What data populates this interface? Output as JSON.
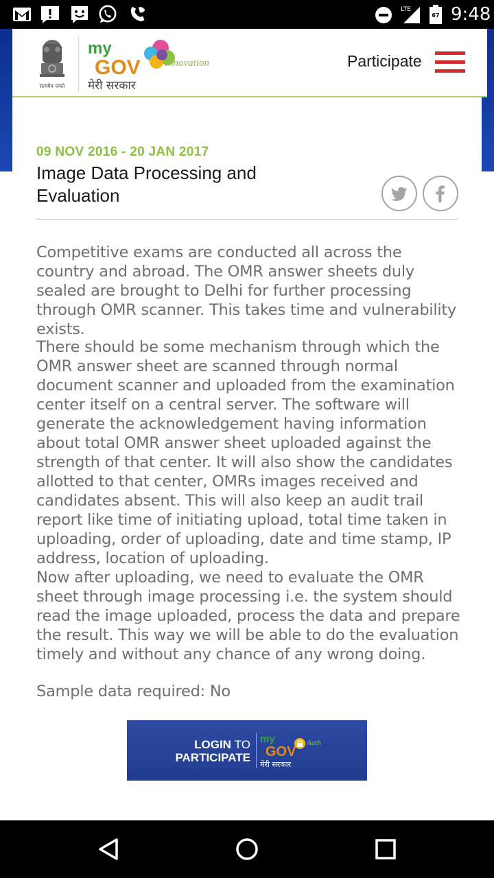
{
  "status_bar": {
    "time": "9:48",
    "network": "LTE",
    "battery_level": "67",
    "icons": [
      "gmail-icon",
      "alert-icon",
      "message-icon",
      "whatsapp-icon",
      "missed-call-icon",
      "do-not-disturb-icon",
      "signal-icon",
      "battery-icon"
    ]
  },
  "header": {
    "logo_brand_lines": [
      "my",
      "GOV",
      "मेरी सरकार",
      "Innovation"
    ],
    "emblem_motto": "सत्यमेव जयते",
    "participate_label": "Participate",
    "menu_icon": "hamburger-menu-icon",
    "colors": {
      "menu": "#d02e2e",
      "divider": "#a8cf74"
    }
  },
  "task": {
    "date_range": "09 NOV 2016 - 20 JAN 2017",
    "title": "Image Data Processing and Evaluation",
    "share": {
      "twitter_icon": "twitter-icon",
      "facebook_icon": "facebook-icon"
    },
    "paragraphs": [
      "Competitive exams are conducted all across the country and abroad. The OMR answer sheets duly sealed are brought to Delhi for further processing through OMR scanner. This takes time and vulnerability exists.",
      "There should be some mechanism through which the OMR answer sheet are scanned through normal document scanner and uploaded from the examination center itself on a central server. The software will generate the acknowledgement having information about total OMR answer sheet uploaded against the strength of that center. It will also show the candidates allotted to that center, OMRs images received and candidates absent. This will also keep an audit trail report like time of initiating upload, total time taken in uploading, order of uploading, date and time stamp, IP address, location of uploading.\nNow after uploading, we need to evaluate the OMR sheet through image processing i.e. the system should read the image uploaded, process the data and prepare the result. This way we will be able to do the evaluation timely and without any chance of any wrong doing.",
      "Sample data required: No"
    ],
    "colors": {
      "date": "#8dc043",
      "body_text": "#6f6f6f"
    }
  },
  "login_button": {
    "line1_bold": "LOGIN",
    "line1_thin": "TO",
    "line2": "PARTICIPATE",
    "logo_lines": [
      "my",
      "GOV",
      "मेरी सरकार",
      "Auth"
    ],
    "color": "#2a4599"
  },
  "nav_bar": {
    "icons": [
      "back-icon",
      "home-icon",
      "recents-icon"
    ]
  }
}
